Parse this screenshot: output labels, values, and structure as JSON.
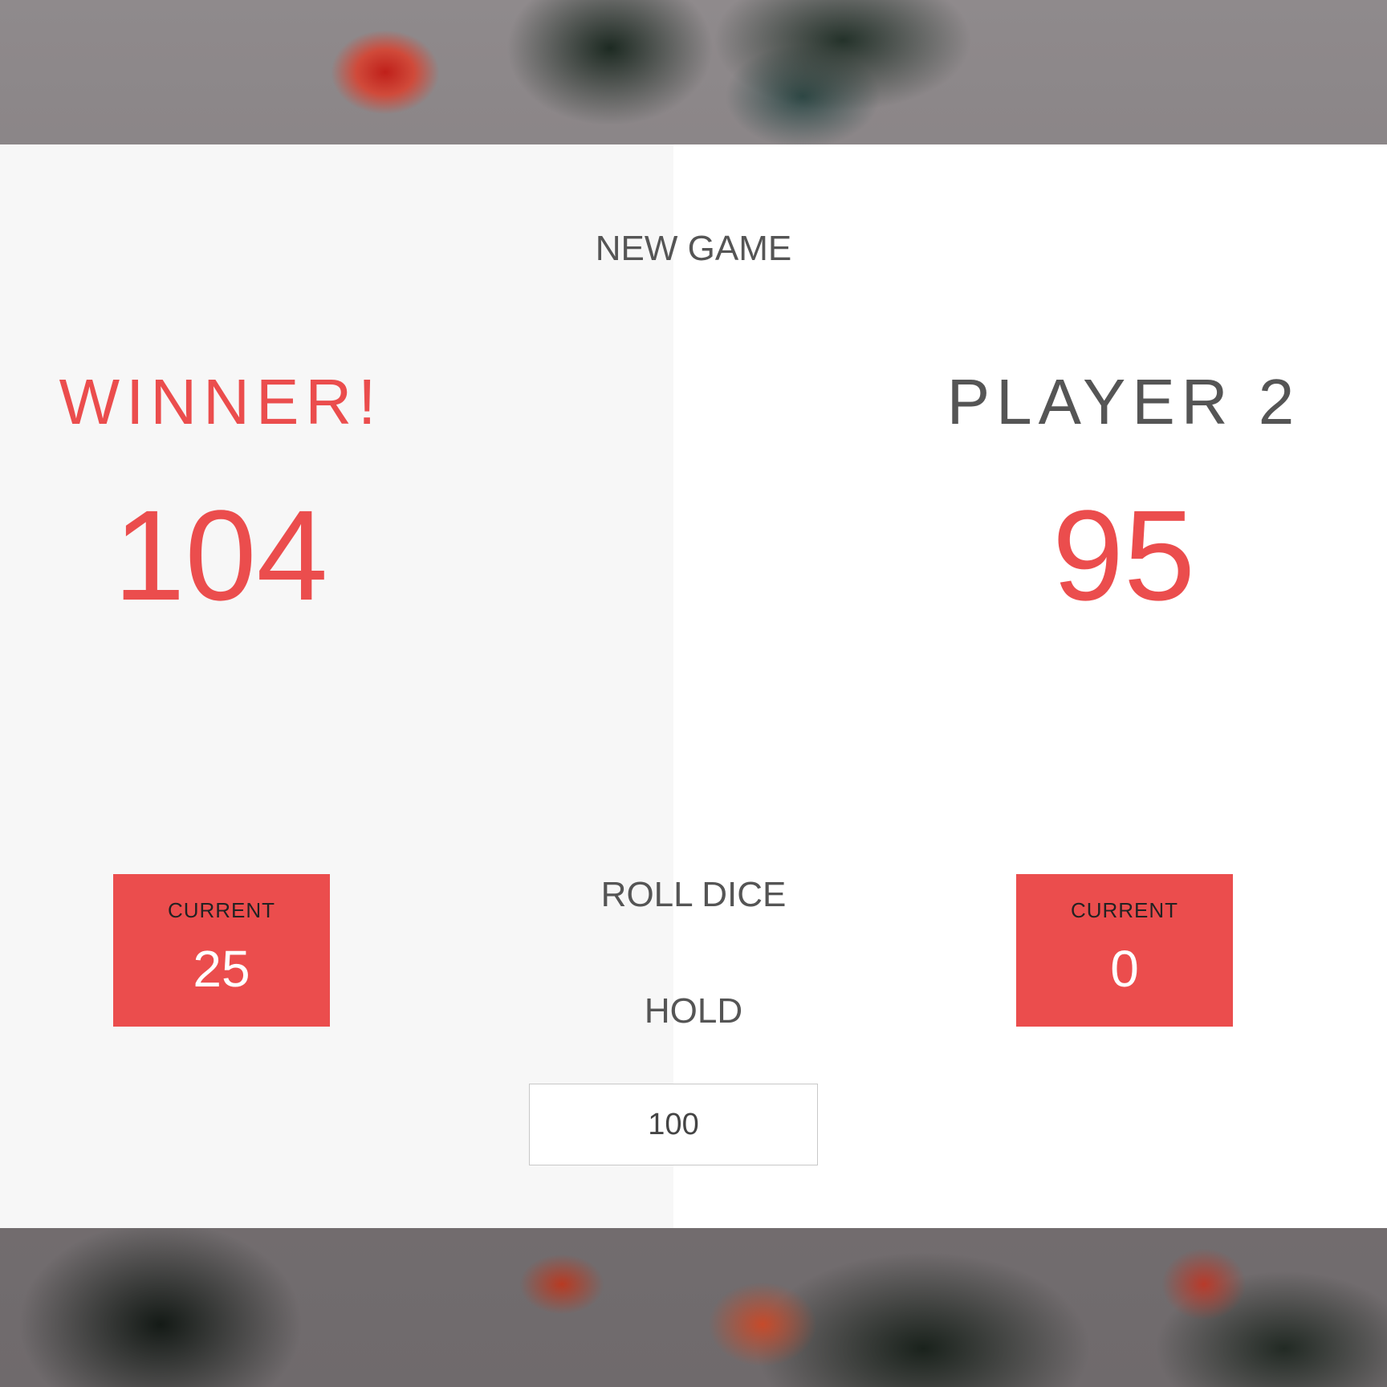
{
  "buttons": {
    "new_game": "NEW GAME",
    "roll_dice": "ROLL DICE",
    "hold": "HOLD"
  },
  "players": [
    {
      "name": "WINNER!",
      "score": "104",
      "current_label": "CURRENT",
      "current_score": "25"
    },
    {
      "name": "PLAYER 2",
      "score": "95",
      "current_label": "CURRENT",
      "current_score": "0"
    }
  ],
  "final_score": {
    "value": "100"
  },
  "colors": {
    "accent": "#eb4d4d",
    "panel_active": "#f7f7f7",
    "panel_inactive": "#ffffff",
    "text": "#555555"
  }
}
